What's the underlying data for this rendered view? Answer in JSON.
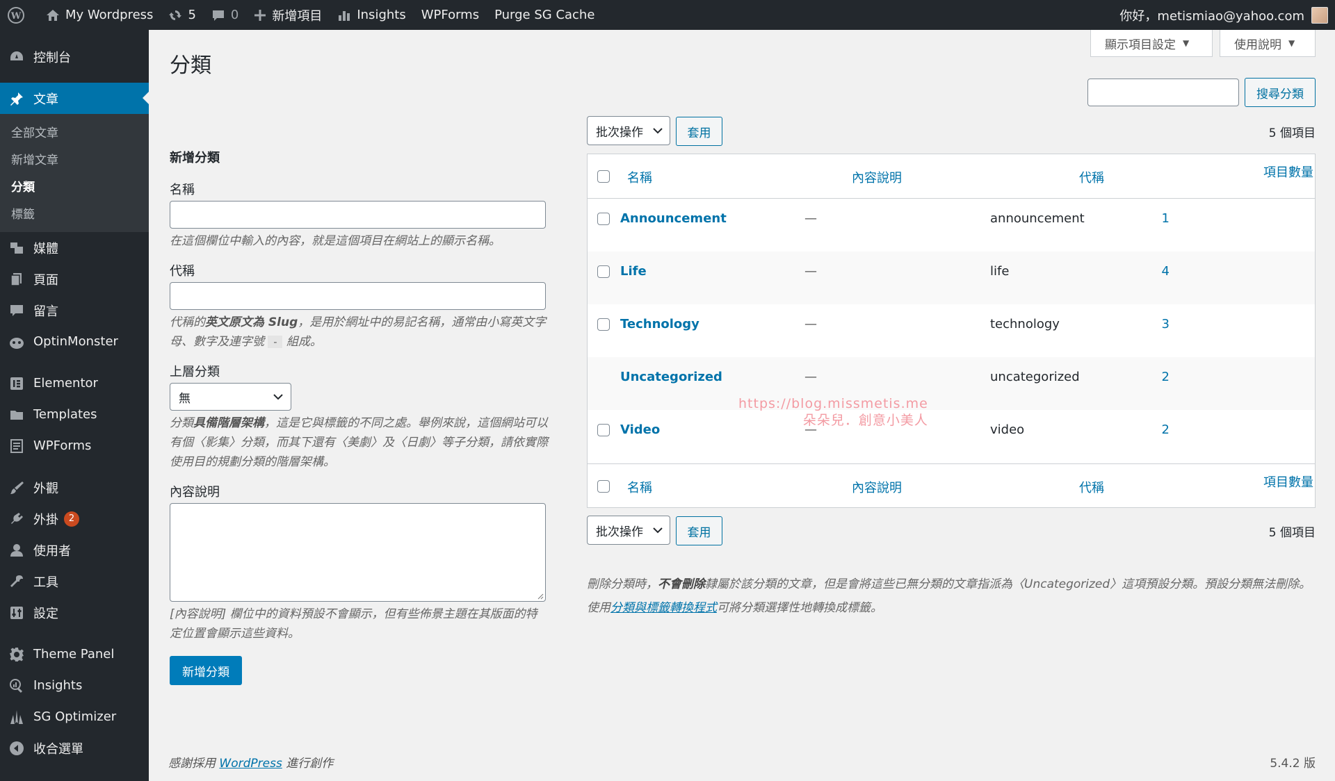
{
  "adminbar": {
    "site_name": "My Wordpress",
    "updates_count": "5",
    "comments_count": "0",
    "new_item": "新增項目",
    "insights": "Insights",
    "wpforms": "WPForms",
    "purge": "Purge SG Cache",
    "greeting": "你好，metismiao@yahoo.com"
  },
  "sidebar": {
    "dashboard": "控制台",
    "posts": "文章",
    "posts_sub": [
      "全部文章",
      "新增文章",
      "分類",
      "標籤"
    ],
    "media": "媒體",
    "pages": "頁面",
    "comments": "留言",
    "optinmonster": "OptinMonster",
    "elementor": "Elementor",
    "templates": "Templates",
    "wpforms": "WPForms",
    "appearance": "外觀",
    "plugins": "外掛",
    "plugins_badge": "2",
    "users": "使用者",
    "tools": "工具",
    "settings": "設定",
    "theme_panel": "Theme Panel",
    "insights": "Insights",
    "sg_optimizer": "SG Optimizer",
    "collapse": "收合選單"
  },
  "header": {
    "screen_options": "顯示項目設定",
    "help": "使用說明",
    "page_title": "分類",
    "search_button": "搜尋分類"
  },
  "form": {
    "heading": "新增分類",
    "name_label": "名稱",
    "name_desc": "在這個欄位中輸入的內容，就是這個項目在網站上的顯示名稱。",
    "slug_label": "代稱",
    "slug_desc_a": "代稱的",
    "slug_desc_b": "英文原文為 Slug",
    "slug_desc_c": "，是用於網址中的易記名稱，通常由小寫英文字母、數字及連字號",
    "slug_desc_code": "-",
    "slug_desc_d": "組成。",
    "parent_label": "上層分類",
    "parent_value": "無",
    "parent_desc_a": "分類",
    "parent_desc_b": "具備階層架構",
    "parent_desc_c": "，這是它與標籤的不同之處。舉例來說，這個網站可以有個〈影集〉分類，而其下還有〈美劇〉及〈日劇〉等子分類，請依實際使用目的規劃分類的階層架構。",
    "description_label": "內容說明",
    "description_desc": "[內容說明] 欄位中的資料預設不會顯示，但有些佈景主題在其版面的特定位置會顯示這些資料。",
    "submit": "新增分類"
  },
  "list": {
    "bulk_actions": "批次操作",
    "apply": "套用",
    "item_count": "5 個項目",
    "columns": {
      "name": "名稱",
      "description": "內容說明",
      "slug": "代稱",
      "count": "項目數量"
    },
    "rows": [
      {
        "name": "Announcement",
        "description": "—",
        "slug": "announcement",
        "count": "1",
        "has_checkbox": true
      },
      {
        "name": "Life",
        "description": "—",
        "slug": "life",
        "count": "4",
        "has_checkbox": true
      },
      {
        "name": "Technology",
        "description": "—",
        "slug": "technology",
        "count": "3",
        "has_checkbox": true
      },
      {
        "name": "Uncategorized",
        "description": "—",
        "slug": "uncategorized",
        "count": "2",
        "has_checkbox": false
      },
      {
        "name": "Video",
        "description": "—",
        "slug": "video",
        "count": "2",
        "has_checkbox": true
      }
    ],
    "watermark_line1": "https://blog.missmetis.me",
    "watermark_line2": "朵朵兒．創意小美人"
  },
  "notes": {
    "delete_a": "刪除分類時，",
    "delete_b": "不會刪除",
    "delete_c": "隸屬於該分類的文章，但是會將這些已無分類的文章指派為〈Uncategorized〉這項預設分類。預設分類無法刪除。",
    "convert_a": "使用",
    "convert_link": "分類與標籤轉換程式",
    "convert_b": "可將分類選擇性地轉換成標籤。"
  },
  "footer": {
    "thanks_a": "感謝採用",
    "thanks_link": "WordPress",
    "thanks_b": "進行創作",
    "version": "5.4.2 版"
  }
}
